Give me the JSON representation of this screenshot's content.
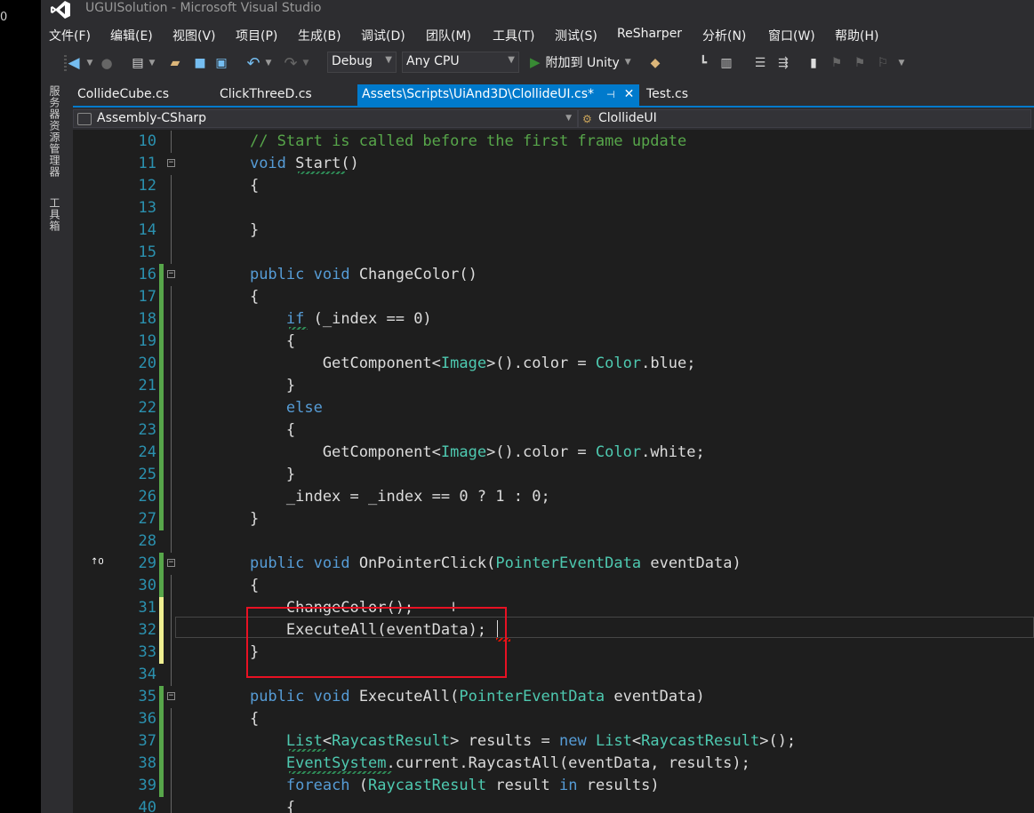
{
  "window": {
    "title": "UGUISolution - Microsoft Visual Studio",
    "desktop_digit": "0"
  },
  "menu": [
    "文件(F)",
    "编辑(E)",
    "视图(V)",
    "项目(P)",
    "生成(B)",
    "调试(D)",
    "团队(M)",
    "工具(T)",
    "测试(S)",
    "ReSharper",
    "分析(N)",
    "窗口(W)",
    "帮助(H)"
  ],
  "toolbar": {
    "config": "Debug",
    "platform": "Any CPU",
    "attach": "附加到 Unity"
  },
  "side_panels": [
    "服务器资源管理器",
    "工具箱"
  ],
  "tabs": [
    {
      "label": "CollideCube.cs"
    },
    {
      "label": "ClickThreeD.cs"
    },
    {
      "label": "Assets\\Scripts\\UiAnd3D\\ClollideUI.cs*",
      "active": true
    },
    {
      "label": "Test.cs"
    }
  ],
  "nav": {
    "project": "Assembly-CSharp",
    "class": "ClollideUI"
  },
  "code_lines": [
    {
      "n": "10",
      "text": "    // Start is called before the first frame update"
    },
    {
      "n": "11",
      "text": "    void Start()"
    },
    {
      "n": "12",
      "text": "    {"
    },
    {
      "n": "13",
      "text": ""
    },
    {
      "n": "14",
      "text": "    }"
    },
    {
      "n": "15",
      "text": ""
    },
    {
      "n": "16",
      "text": "    public void ChangeColor()"
    },
    {
      "n": "17",
      "text": "    {"
    },
    {
      "n": "18",
      "text": "        if (_index == 0)"
    },
    {
      "n": "19",
      "text": "        {"
    },
    {
      "n": "20",
      "text": "            GetComponent<Image>().color = Color.blue;"
    },
    {
      "n": "21",
      "text": "        }"
    },
    {
      "n": "22",
      "text": "        else"
    },
    {
      "n": "23",
      "text": "        {"
    },
    {
      "n": "24",
      "text": "            GetComponent<Image>().color = Color.white;"
    },
    {
      "n": "25",
      "text": "        }"
    },
    {
      "n": "26",
      "text": "        _index = _index == 0 ? 1 : 0;"
    },
    {
      "n": "27",
      "text": "    }"
    },
    {
      "n": "28",
      "text": ""
    },
    {
      "n": "29",
      "text": "    public void OnPointerClick(PointerEventData eventData)"
    },
    {
      "n": "30",
      "text": "    {"
    },
    {
      "n": "31",
      "text": "        ChangeColor();"
    },
    {
      "n": "32",
      "text": "        ExecuteAll(eventData);"
    },
    {
      "n": "33",
      "text": "    }"
    },
    {
      "n": "34",
      "text": ""
    },
    {
      "n": "35",
      "text": "    public void ExecuteAll(PointerEventData eventData)"
    },
    {
      "n": "36",
      "text": "    {"
    },
    {
      "n": "37",
      "text": "        List<RaycastResult> results = new List<RaycastResult>();"
    },
    {
      "n": "38",
      "text": "        EventSystem.current.RaycastAll(eventData, results);"
    },
    {
      "n": "39",
      "text": "        foreach (RaycastResult result in results)"
    },
    {
      "n": "40",
      "text": "        {"
    }
  ],
  "colors": {
    "keyword": "#569cd6",
    "type": "#4ec9b0",
    "comment": "#57a64a",
    "line_number": "#2b91af",
    "accent": "#007acc",
    "annotation": "#e81123"
  }
}
